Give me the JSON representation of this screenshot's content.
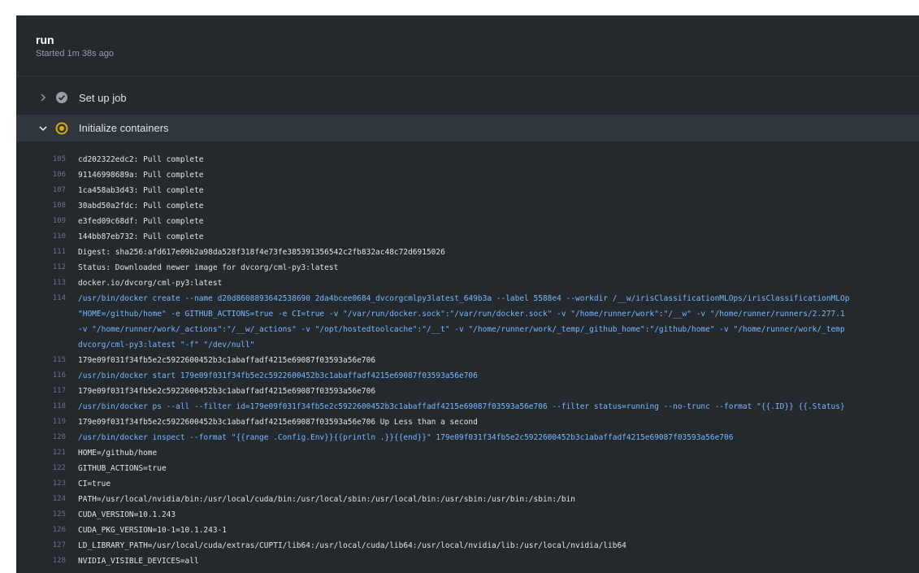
{
  "job": {
    "title": "run",
    "started": "Started 1m 38s ago"
  },
  "steps": [
    {
      "label": "Set up job",
      "state": "success",
      "expanded": false,
      "icon": "check-circle-icon"
    },
    {
      "label": "Initialize containers",
      "state": "in_progress",
      "expanded": true,
      "icon": "in-progress-icon"
    }
  ],
  "colors": {
    "panel_bg": "#24292e",
    "active_step_bg": "#2f363d",
    "command_text": "#79b8ff",
    "in_progress": "#dbab09",
    "success": "#959da5"
  },
  "log": {
    "lines": [
      {
        "n": "105",
        "text": "cd202322edc2: Pull complete"
      },
      {
        "n": "106",
        "text": "91146998689a: Pull complete"
      },
      {
        "n": "107",
        "text": "1ca458ab3d43: Pull complete"
      },
      {
        "n": "108",
        "text": "30abd50a2fdc: Pull complete"
      },
      {
        "n": "109",
        "text": "e3fed09c68df: Pull complete"
      },
      {
        "n": "110",
        "text": "144bb87eb732: Pull complete"
      },
      {
        "n": "111",
        "text": "Digest: sha256:afd617e09b2a98da528f318f4e73fe385391356542c2fb832ac48c72d6915026"
      },
      {
        "n": "112",
        "text": "Status: Downloaded newer image for dvcorg/cml-py3:latest"
      },
      {
        "n": "113",
        "text": "docker.io/dvcorg/cml-py3:latest"
      },
      {
        "n": "114",
        "text": "/usr/bin/docker create --name d20d8608893642538690 2da4bcee0684_dvcorgcmlpy3latest_649b3a --label 5588e4 --workdir /__w/irisClassificationMLOps/irisClassificationMLOp"
      },
      {
        "n": "",
        "text": "\"HOME=/github/home\" -e GITHUB_ACTIONS=true -e CI=true -v \"/var/run/docker.sock\":\"/var/run/docker.sock\" -v \"/home/runner/work\":\"/__w\" -v \"/home/runner/runners/2.277.1"
      },
      {
        "n": "",
        "text": "-v \"/home/runner/work/_actions\":\"/__w/_actions\" -v \"/opt/hostedtoolcache\":\"/__t\" -v \"/home/runner/work/_temp/_github_home\":\"/github/home\" -v \"/home/runner/work/_temp"
      },
      {
        "n": "",
        "text": "dvcorg/cml-py3:latest \"-f\" \"/dev/null\""
      },
      {
        "n": "115",
        "text": "179e09f031f34fb5e2c5922600452b3c1abaffadf4215e69087f03593a56e706"
      },
      {
        "n": "116",
        "text": "/usr/bin/docker start 179e09f031f34fb5e2c5922600452b3c1abaffadf4215e69087f03593a56e706"
      },
      {
        "n": "117",
        "text": "179e09f031f34fb5e2c5922600452b3c1abaffadf4215e69087f03593a56e706"
      },
      {
        "n": "118",
        "text": "/usr/bin/docker ps --all --filter id=179e09f031f34fb5e2c5922600452b3c1abaffadf4215e69087f03593a56e706 --filter status=running --no-trunc --format \"{{.ID}} {{.Status}"
      },
      {
        "n": "119",
        "text": "179e09f031f34fb5e2c5922600452b3c1abaffadf4215e69087f03593a56e706 Up Less than a second"
      },
      {
        "n": "120",
        "text": "/usr/bin/docker inspect --format \"{{range .Config.Env}}{{println .}}{{end}}\" 179e09f031f34fb5e2c5922600452b3c1abaffadf4215e69087f03593a56e706"
      },
      {
        "n": "121",
        "text": "HOME=/github/home"
      },
      {
        "n": "122",
        "text": "GITHUB_ACTIONS=true"
      },
      {
        "n": "123",
        "text": "CI=true"
      },
      {
        "n": "124",
        "text": "PATH=/usr/local/nvidia/bin:/usr/local/cuda/bin:/usr/local/sbin:/usr/local/bin:/usr/sbin:/usr/bin:/sbin:/bin"
      },
      {
        "n": "125",
        "text": "CUDA_VERSION=10.1.243"
      },
      {
        "n": "126",
        "text": "CUDA_PKG_VERSION=10-1=10.1.243-1"
      },
      {
        "n": "127",
        "text": "LD_LIBRARY_PATH=/usr/local/cuda/extras/CUPTI/lib64:/usr/local/cuda/lib64:/usr/local/nvidia/lib:/usr/local/nvidia/lib64"
      },
      {
        "n": "128",
        "text": "NVIDIA_VISIBLE_DEVICES=all"
      }
    ]
  }
}
